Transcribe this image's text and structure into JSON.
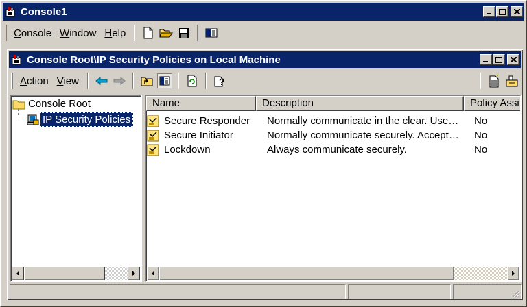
{
  "app": {
    "title": "Console1",
    "menu": [
      {
        "accel": "C",
        "rest": "onsole"
      },
      {
        "accel": "W",
        "rest": "indow"
      },
      {
        "accel": "H",
        "rest": "elp"
      }
    ],
    "toolbar_icons": [
      "new-document-icon",
      "open-folder-icon",
      "save-disk-icon",
      "console-tree-icon"
    ]
  },
  "child": {
    "title": "Console Root\\IP Security Policies on Local Machine",
    "menu": [
      {
        "accel": "A",
        "rest": "ction"
      },
      {
        "accel": "V",
        "rest": "iew"
      }
    ],
    "toolbar_icons": [
      "back-arrow-icon",
      "forward-arrow-icon",
      "up-level-icon",
      "show-hide-tree-icon",
      "refresh-icon",
      "help-icon",
      "add-policy-icon",
      "manage-filters-icon"
    ]
  },
  "tree": {
    "root": "Console Root",
    "child": "IP Security Policies"
  },
  "list": {
    "columns": [
      "Name",
      "Description",
      "Policy Assi"
    ],
    "rows": [
      {
        "name": "Secure Responder",
        "description": "Normally communicate in the clear. Use…",
        "assigned": "No"
      },
      {
        "name": "Secure Initiator",
        "description": "Normally communicate securely. Accept…",
        "assigned": "No"
      },
      {
        "name": "Lockdown",
        "description": "Always communicate securely.",
        "assigned": "No"
      }
    ]
  },
  "colors": {
    "titlebar": "#0a246a",
    "face": "#d4d0c8",
    "selection": "#0a246a"
  }
}
